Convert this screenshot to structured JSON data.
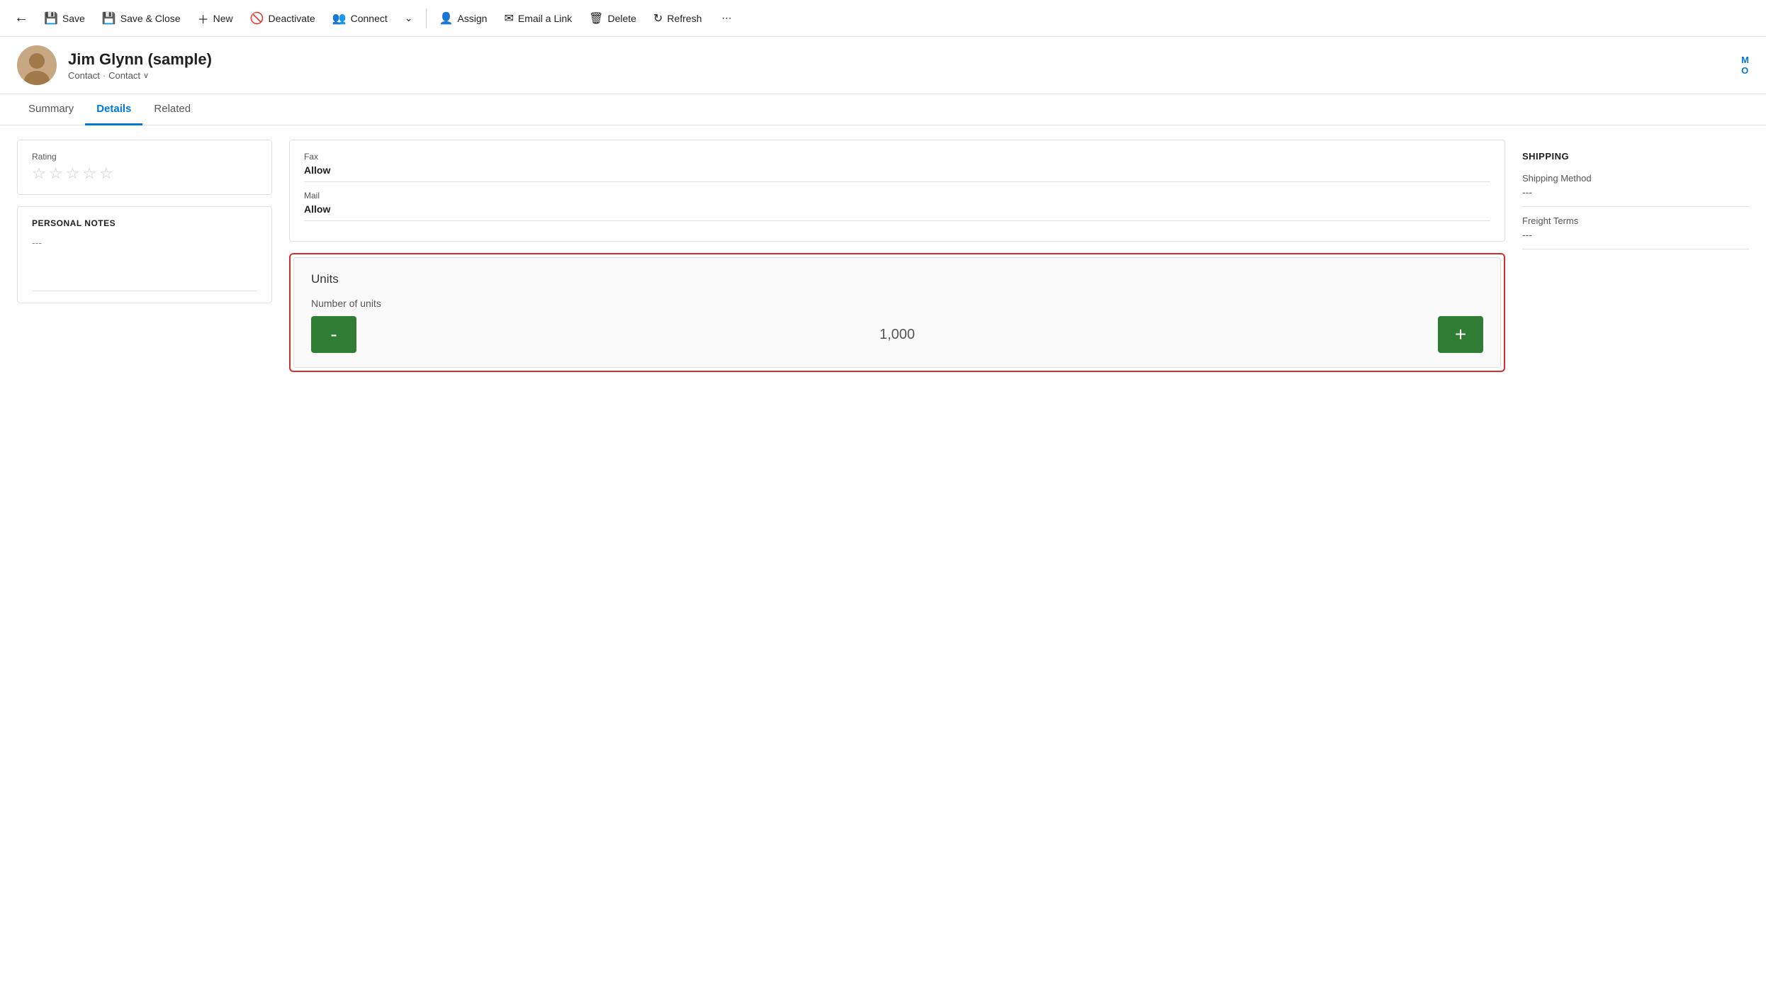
{
  "toolbar": {
    "back_icon": "←",
    "save_label": "Save",
    "save_close_label": "Save & Close",
    "new_label": "New",
    "deactivate_label": "Deactivate",
    "connect_label": "Connect",
    "dropdown_icon": "⌄",
    "assign_label": "Assign",
    "email_link_label": "Email a Link",
    "delete_label": "Delete",
    "refresh_label": "Refresh",
    "more_icon": "⋯"
  },
  "header": {
    "name": "Jim Glynn (sample)",
    "breadcrumb1": "Contact",
    "breadcrumb_sep": "·",
    "breadcrumb2": "Contact",
    "dropdown_arrow": "∨",
    "right_initial": "M",
    "right_label2": "O"
  },
  "tabs": [
    {
      "id": "summary",
      "label": "Summary",
      "active": false
    },
    {
      "id": "details",
      "label": "Details",
      "active": true
    },
    {
      "id": "related",
      "label": "Related",
      "active": false
    }
  ],
  "rating": {
    "label": "Rating",
    "stars": [
      "☆",
      "☆",
      "☆",
      "☆",
      "☆"
    ]
  },
  "personal_notes": {
    "title": "PERSONAL NOTES",
    "value": "---"
  },
  "contact_section": {
    "fax_label": "Fax",
    "fax_allow_label": "Allow",
    "fax_allow_value": "Allow",
    "mail_label": "Mail",
    "mail_allow_label": "Allow",
    "mail_allow_value": "Allow"
  },
  "shipping": {
    "title": "SHIPPING",
    "method_label": "Shipping Method",
    "method_value": "---",
    "terms_label": "Freight Terms",
    "terms_value": "---"
  },
  "units": {
    "outer_title": "Units",
    "number_label": "Number of units",
    "value": "1,000",
    "minus_label": "-",
    "plus_label": "+"
  }
}
